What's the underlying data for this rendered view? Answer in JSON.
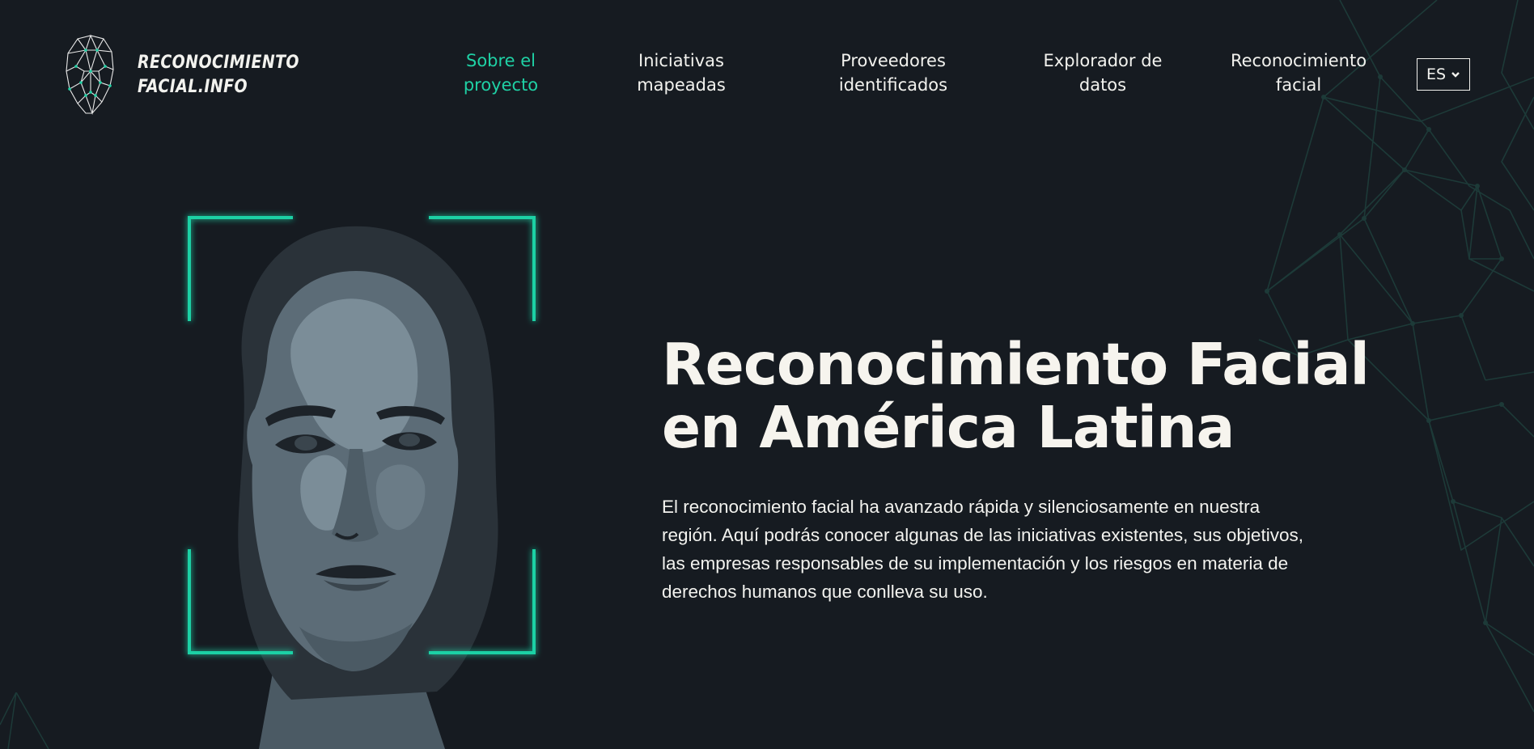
{
  "logo": {
    "line1": "RECONOCIMIENTO",
    "line2": "FACIAL.INFO",
    "icon": "face-mesh-icon"
  },
  "nav": {
    "items": [
      {
        "line1": "Sobre el",
        "line2": "proyecto",
        "active": true
      },
      {
        "line1": "Iniciativas",
        "line2": "mapeadas",
        "active": false
      },
      {
        "line1": "Proveedores",
        "line2": "identificados",
        "active": false
      },
      {
        "line1": "Explorador de",
        "line2": "datos",
        "active": false
      },
      {
        "line1": "Reconocimiento",
        "line2": "facial",
        "active": false
      }
    ]
  },
  "language": {
    "selected": "ES",
    "icon": "chevron-down-icon"
  },
  "hero": {
    "title_line1": "Reconocimiento Facial",
    "title_line2": "en América Latina",
    "description": "El reconocimiento facial ha avanzado rápida y silenciosamente en nuestra región. Aquí podrás conocer algunas de las iniciativas existentes, sus objetivos, las empresas responsables de su implementación y los riesgos en materia de derechos humanos que conlleva su uso."
  },
  "colors": {
    "background": "#161b21",
    "accent": "#1fd1a5",
    "text": "#f2f2ee",
    "network_lines": "#1d3a38"
  }
}
